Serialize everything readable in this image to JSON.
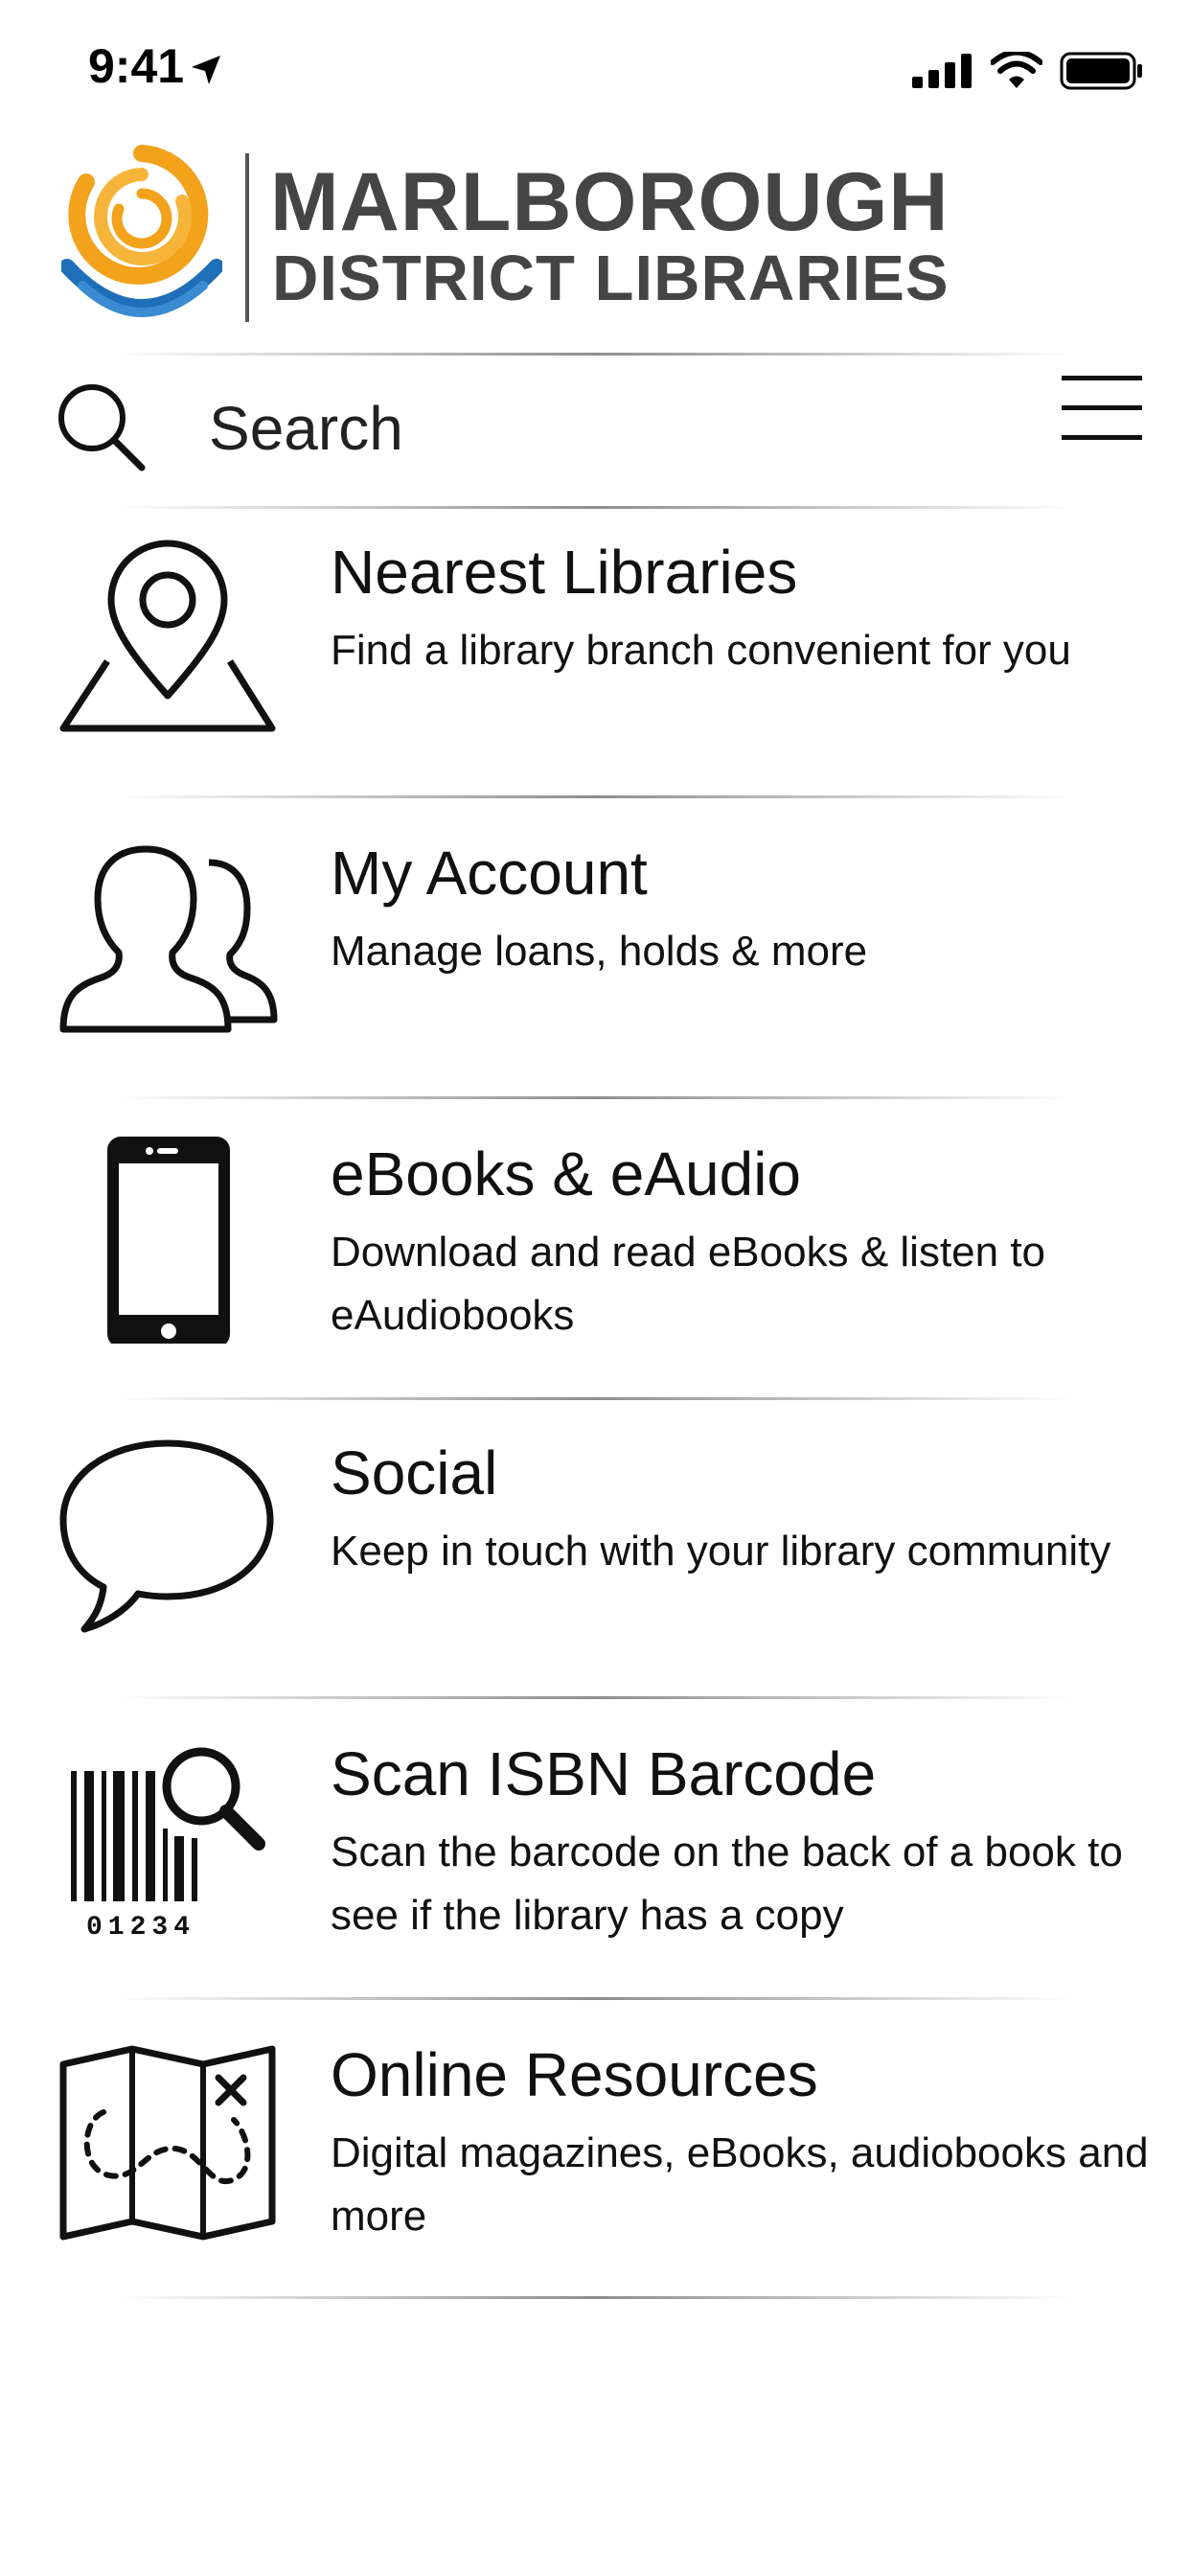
{
  "status_bar": {
    "time": "9:41",
    "icons": [
      "location-arrow-icon",
      "signal-icon",
      "wifi-icon",
      "battery-icon"
    ]
  },
  "header": {
    "logo_line1": "MARLBOROUGH",
    "logo_line2": "DISTRICT LIBRARIES",
    "brand_colors": {
      "orange": "#F2A21B",
      "blue": "#1F6FB8",
      "text": "#454545"
    }
  },
  "search": {
    "placeholder": "Search",
    "icon": "search-icon",
    "menu_icon": "hamburger-menu-icon"
  },
  "menu": {
    "items": [
      {
        "title": "Nearest Libraries",
        "desc": "Find a library branch convenient for you",
        "icon": "map-pin-icon"
      },
      {
        "title": "My Account",
        "desc": "Manage loans, holds & more",
        "icon": "users-icon"
      },
      {
        "title": "eBooks & eAudio",
        "desc": "Download and read eBooks & listen to eAudiobooks",
        "icon": "smartphone-icon"
      },
      {
        "title": "Social",
        "desc": "Keep in touch with your library community",
        "icon": "speech-bubble-icon"
      },
      {
        "title": "Scan ISBN Barcode",
        "desc": "Scan the barcode on the back of a book to see if the library has a copy",
        "icon": "barcode-scan-icon",
        "barcode_digits": "01234"
      },
      {
        "title": "Online Resources",
        "desc": "Digital magazines, eBooks, audiobooks and more",
        "icon": "treasure-map-icon"
      }
    ]
  }
}
